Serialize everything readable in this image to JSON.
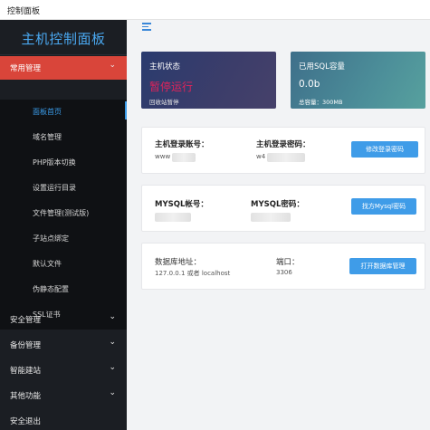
{
  "window": {
    "title": "控制面板"
  },
  "sidebar": {
    "brand": "主机控制面板",
    "groups": [
      {
        "label": "常用管理",
        "open": true
      },
      {
        "label": "安全管理"
      },
      {
        "label": "备份管理"
      },
      {
        "label": "智能建站"
      },
      {
        "label": "其他功能"
      },
      {
        "label": "安全退出"
      }
    ],
    "sub_items": [
      {
        "label": "面板首页",
        "active": true
      },
      {
        "label": "域名管理"
      },
      {
        "label": "PHP版本切换"
      },
      {
        "label": "设置运行目录"
      },
      {
        "label": "文件管理(测试版)"
      },
      {
        "label": "子站点绑定"
      },
      {
        "label": "默认文件"
      },
      {
        "label": "伪静态配置"
      },
      {
        "label": "SSL证书"
      }
    ]
  },
  "cards": {
    "status": {
      "title": "主机状态",
      "value": "暂停运行",
      "note": "回收站暂停"
    },
    "sql": {
      "title": "已用SQL容量",
      "value": "0.0b",
      "note": "总容量：300MB"
    }
  },
  "login": {
    "account_label": "主机登录账号：",
    "account_value": "www",
    "password_label": "主机登录密码：",
    "password_value": "w4",
    "button": "修改登录密码"
  },
  "mysql": {
    "account_label": "MYSQL帐号：",
    "password_label": "MYSQL密码：",
    "button": "找方Mysql密码"
  },
  "database": {
    "address_label": "数据库地址：",
    "address_value": "127.0.0.1 或者 localhost",
    "port_label": "端口：",
    "port_value": "3306",
    "button": "打开数据库管理"
  },
  "colors": {
    "accent": "#3f9ce8",
    "sidebar_bg": "#1b1e23",
    "active_group": "#d9453a",
    "status_red": "#e1235a"
  }
}
